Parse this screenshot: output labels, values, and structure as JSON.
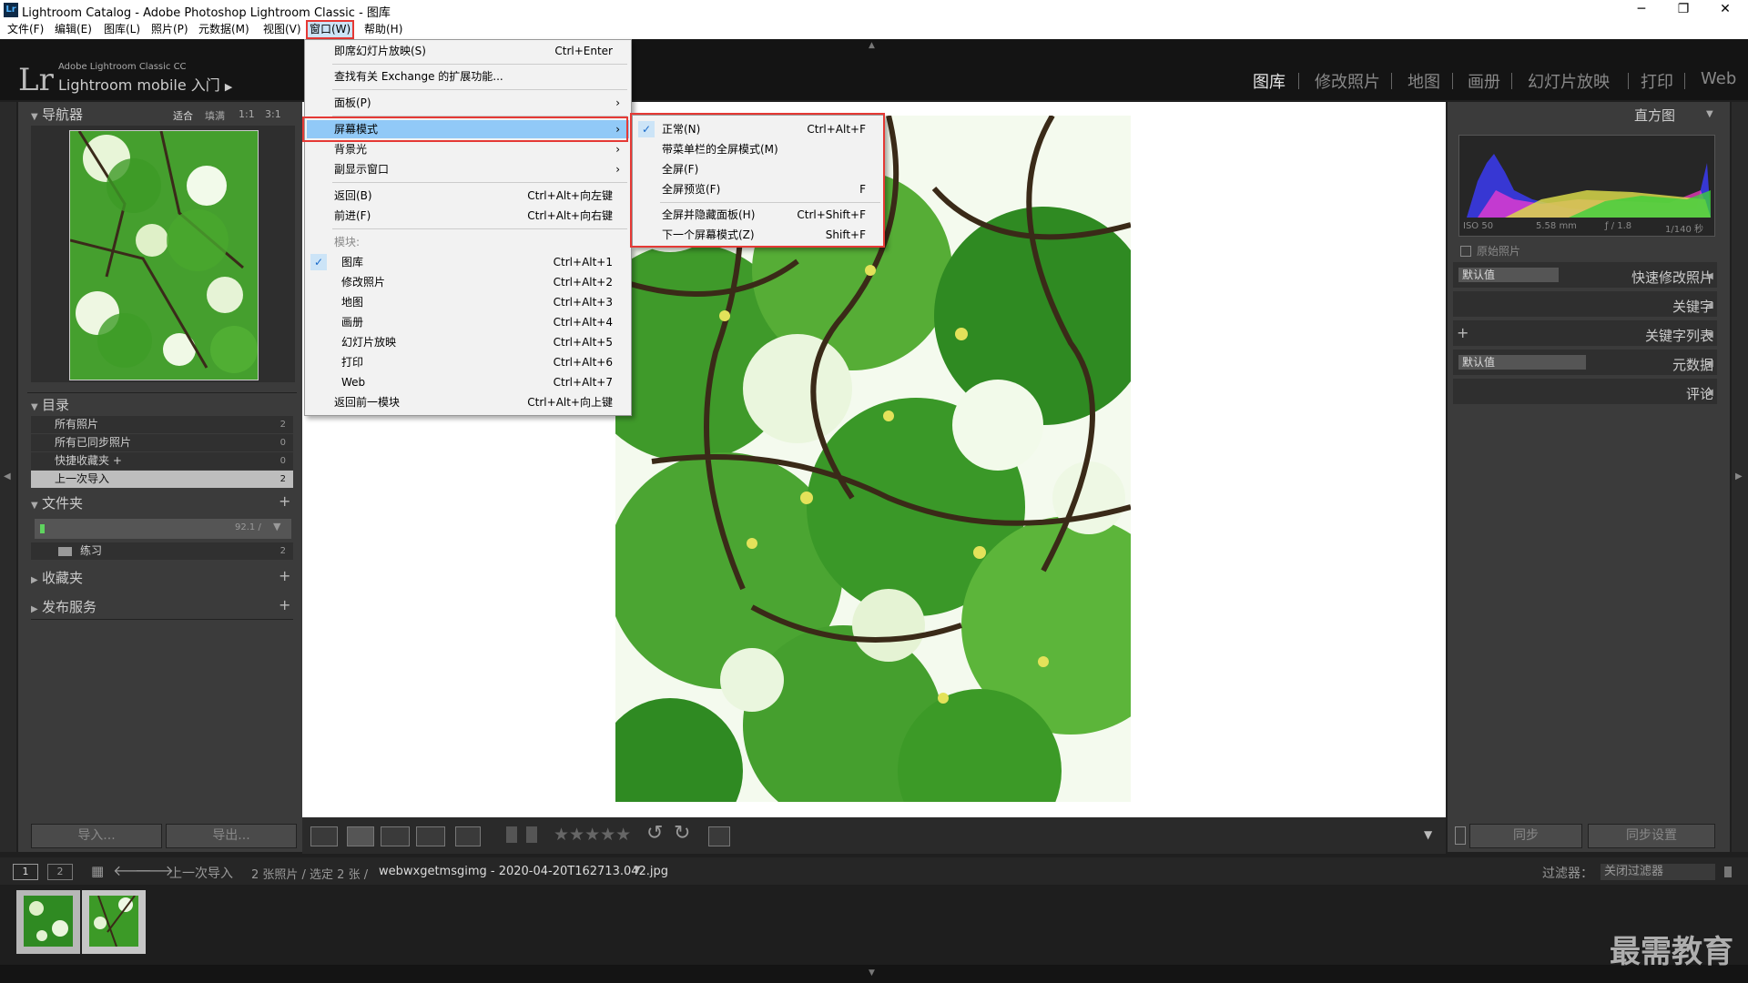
{
  "window": {
    "title": "Lightroom Catalog - Adobe Photoshop Lightroom Classic - 图库",
    "controls": {
      "minimize": "─",
      "maximize": "❐",
      "close": "✕"
    }
  },
  "menubar": {
    "items": [
      "文件(F)",
      "编辑(E)",
      "图库(L)",
      "照片(P)",
      "元数据(M)",
      "视图(V)",
      "窗口(W)",
      "帮助(H)"
    ]
  },
  "brand": {
    "logo": "Lr",
    "line1": "Adobe Lightroom Classic CC",
    "line2": "Lightroom mobile 入门",
    "arrow": "▶"
  },
  "modules": [
    "图库",
    "修改照片",
    "地图",
    "画册",
    "幻灯片放映",
    "打印",
    "Web"
  ],
  "navigator": {
    "title": "导航器",
    "options": [
      "适合",
      "填满",
      "1:1",
      "3:1"
    ]
  },
  "catalog": {
    "title": "目录",
    "rows": [
      {
        "label": "所有照片",
        "count": "2"
      },
      {
        "label": "所有已同步照片",
        "count": "0"
      },
      {
        "label": "快捷收藏夹 +",
        "count": "0"
      },
      {
        "label": "上一次导入",
        "count": "2"
      }
    ]
  },
  "folders": {
    "title": "文件夹",
    "volume_size": "92.1 /",
    "item": {
      "label": "练习",
      "count": "2"
    }
  },
  "collections": {
    "title": "收藏夹"
  },
  "publish": {
    "title": "发布服务"
  },
  "left_buttons": {
    "import": "导入...",
    "export": "导出..."
  },
  "histogram": {
    "title": "直方图",
    "iso": "ISO 50",
    "focal": "5.58 mm",
    "aperture": "ƒ / 1.8",
    "shutter": "1/140 秒",
    "original": "原始照片"
  },
  "right_panels": {
    "preset_value": "默认值",
    "quick_develop": "快速修改照片",
    "keywording": "关键字",
    "keyword_list": "关键字列表",
    "metadata": "元数据",
    "comments": "评论"
  },
  "right_buttons": {
    "sync": "同步",
    "sync_settings": "同步设置"
  },
  "toolbar": {
    "stars": "★★★★★"
  },
  "filmbar": {
    "page1": "1",
    "page2": "2",
    "source": "上一次导入",
    "info": "2 张照片 / 选定 2 张 /",
    "filename": "webwxgetmsgimg - 2020-04-20T162713.042.jpg",
    "filter_label": "过滤器：",
    "filter_value": "关闭过滤器"
  },
  "window_menu": {
    "items": [
      {
        "label": "即席幻灯片放映(S)",
        "shortcut": "Ctrl+Enter"
      },
      {
        "label": "查找有关 Exchange 的扩展功能..."
      },
      {
        "label": "面板(P)",
        "arrow": "›"
      },
      {
        "label": "屏幕模式",
        "arrow": "›"
      },
      {
        "label": "背景光",
        "arrow": "›"
      },
      {
        "label": "副显示窗口",
        "arrow": "›"
      },
      {
        "label": "返回(B)",
        "shortcut": "Ctrl+Alt+向左键"
      },
      {
        "label": "前进(F)",
        "shortcut": "Ctrl+Alt+向右键"
      },
      {
        "label": "模块:"
      },
      {
        "label": "图库",
        "shortcut": "Ctrl+Alt+1",
        "check": "✓"
      },
      {
        "label": "修改照片",
        "shortcut": "Ctrl+Alt+2"
      },
      {
        "label": "地图",
        "shortcut": "Ctrl+Alt+3"
      },
      {
        "label": "画册",
        "shortcut": "Ctrl+Alt+4"
      },
      {
        "label": "幻灯片放映",
        "shortcut": "Ctrl+Alt+5"
      },
      {
        "label": "打印",
        "shortcut": "Ctrl+Alt+6"
      },
      {
        "label": "Web",
        "shortcut": "Ctrl+Alt+7"
      },
      {
        "label": "返回前一模块",
        "shortcut": "Ctrl+Alt+向上键"
      }
    ]
  },
  "screen_mode_menu": {
    "items": [
      {
        "label": "正常(N)",
        "shortcut": "Ctrl+Alt+F",
        "check": "✓"
      },
      {
        "label": "带菜单栏的全屏模式(M)"
      },
      {
        "label": "全屏(F)"
      },
      {
        "label": "全屏预览(F)",
        "shortcut": "F"
      },
      {
        "label": "全屏并隐藏面板(H)",
        "shortcut": "Ctrl+Shift+F"
      },
      {
        "label": "下一个屏幕模式(Z)",
        "shortcut": "Shift+F"
      }
    ]
  },
  "watermark": "最需教育",
  "colors": {
    "highlight_box": "#e53935",
    "menu_highlight": "#91c9f7",
    "panel_bg": "#3b3b3b"
  }
}
